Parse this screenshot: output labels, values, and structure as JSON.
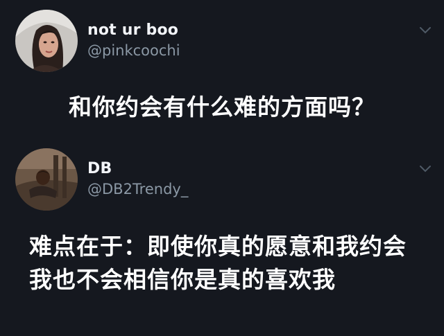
{
  "tweets": [
    {
      "name": "not ur boo",
      "handle": "@pinkcoochi",
      "avatar_icon": "profile-photo-woman",
      "menu_icon": "chevron-down-icon",
      "text": "和你约会有什么难的方面吗？"
    },
    {
      "name": "DB",
      "handle": "@DB2Trendy_",
      "avatar_icon": "profile-photo-man",
      "menu_icon": "chevron-down-icon",
      "text_lines": [
        "难点在于：即使你真的愿意和我约会",
        "我也不会相信你是真的喜欢我"
      ]
    }
  ],
  "colors": {
    "background": "#15181f",
    "name": "#f2f4f8",
    "handle": "#8b98a5",
    "chevron": "#4f5a66"
  }
}
